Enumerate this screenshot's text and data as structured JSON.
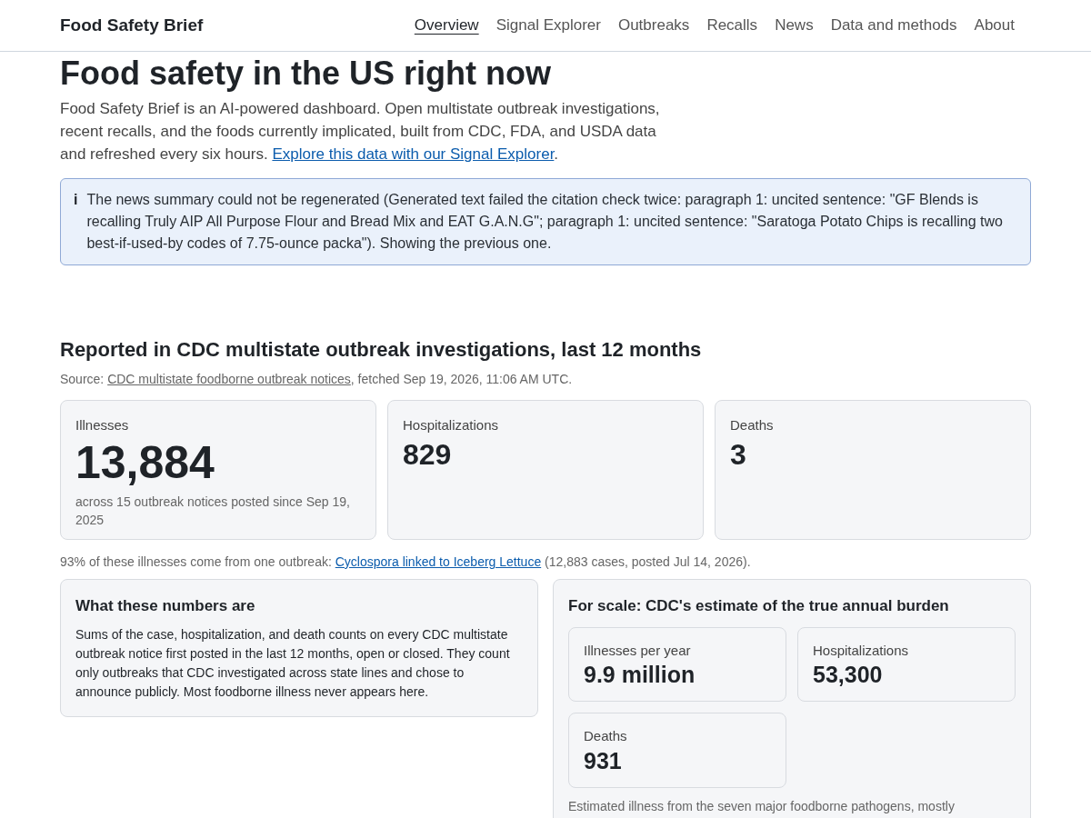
{
  "header": {
    "brand": "Food Safety Brief",
    "nav": [
      {
        "label": "Overview",
        "selected": true
      },
      {
        "label": "Signal Explorer",
        "selected": false
      },
      {
        "label": "Outbreaks",
        "selected": false
      },
      {
        "label": "Recalls",
        "selected": false
      },
      {
        "label": "News",
        "selected": false
      },
      {
        "label": "Data and methods",
        "selected": false
      },
      {
        "label": "About",
        "selected": false
      }
    ]
  },
  "page_title": "Food safety in the US right now",
  "intro": {
    "text": "Food Safety Brief is an AI-powered dashboard. Open multistate outbreak investigations, recent recalls, and the foods currently implicated, built from CDC, FDA, and USDA data and refreshed every six hours.",
    "link": "Explore this data with our Signal Explorer",
    "tail": "."
  },
  "notice": {
    "icon": "i",
    "text": "The news summary could not be regenerated (Generated text failed the citation check twice: paragraph 1: uncited sentence: \"GF Blends is recalling Truly AIP All Purpose Flour and Bread Mix and EAT G.A.N.G\"; paragraph 1: uncited sentence: \"Saratoga Potato Chips is recalling two best-if-used-by codes of 7.75-ounce packa\"). Showing the previous one."
  },
  "section": {
    "heading": "Reported in CDC multistate outbreak investigations, last 12 months",
    "source_prefix": "Source:",
    "source_link": "CDC multistate foodborne outbreak notices",
    "source_suffix": ", fetched Sep 19, 2026, 11:06 AM UTC.",
    "stats": [
      {
        "kind": "primary",
        "label": "Illnesses",
        "value": "13,884",
        "note": "across 15 outbreak notices posted since Sep 19, 2025"
      },
      {
        "kind": "secondary",
        "label": "Hospitalizations",
        "value": "829"
      },
      {
        "kind": "secondary",
        "label": "Deaths",
        "value": "3"
      }
    ],
    "footnote_prefix": "93% of these illnesses come from one outbreak:",
    "footnote_link": "Cyclospora linked to Iceberg Lettuce",
    "footnote_suffix": "(12,883 cases, posted Jul 14, 2026)."
  },
  "explainer": {
    "title": "What these numbers are",
    "text": "Sums of the case, hospitalization, and death counts on every CDC multistate outbreak notice first posted in the last 12 months, open or closed. They count only outbreaks that CDC investigated across state lines and chose to announce publicly. Most foodborne illness never appears here."
  },
  "scale": {
    "title": "For scale: CDC's estimate of the true annual burden",
    "stats": [
      {
        "label": "Illnesses per year",
        "value": "9.9 million"
      },
      {
        "label": "Hospitalizations",
        "value": "53,300"
      },
      {
        "label": "Deaths",
        "value": "931"
      }
    ],
    "note": "Estimated illness from the seven major foodborne pathogens, mostly"
  }
}
